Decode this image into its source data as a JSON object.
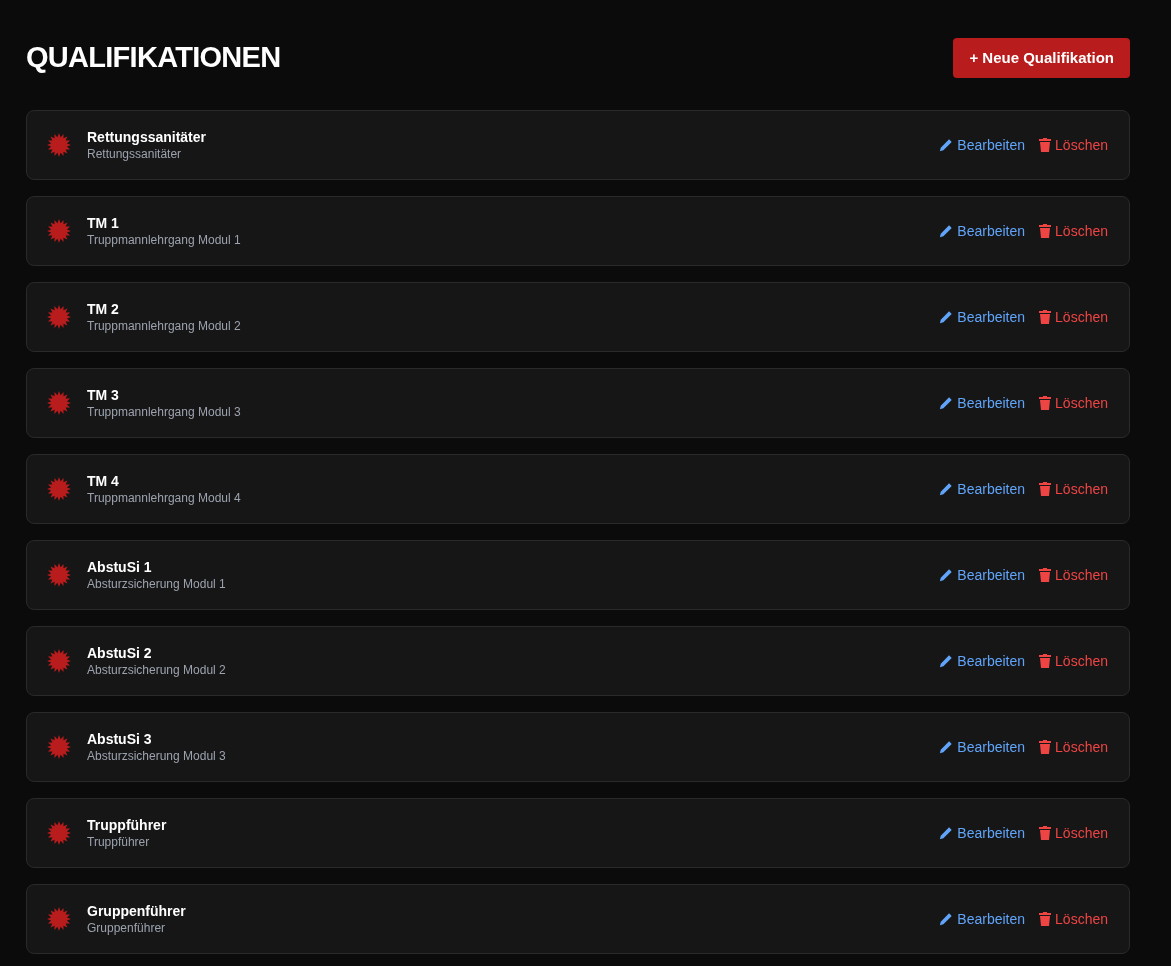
{
  "title": "QUALIFIKATIONEN",
  "add_button": "+ Neue Qualifikation",
  "items": [
    {
      "name": "Rettungssanitäter",
      "description": "Rettungssanitäter",
      "edit": "Bearbeiten",
      "delete": "Löschen"
    },
    {
      "name": "TM 1",
      "description": "Truppmannlehrgang Modul 1",
      "edit": "Bearbeiten",
      "delete": "Löschen"
    },
    {
      "name": "TM 2",
      "description": "Truppmannlehrgang Modul 2",
      "edit": "Bearbeiten",
      "delete": "Löschen"
    },
    {
      "name": "TM 3",
      "description": "Truppmannlehrgang Modul 3",
      "edit": "Bearbeiten",
      "delete": "Löschen"
    },
    {
      "name": "TM 4",
      "description": "Truppmannlehrgang Modul 4",
      "edit": "Bearbeiten",
      "delete": "Löschen"
    },
    {
      "name": "AbstuSi 1",
      "description": "Absturzsicherung Modul 1",
      "edit": "Bearbeiten",
      "delete": "Löschen"
    },
    {
      "name": "AbstuSi 2",
      "description": "Absturzsicherung Modul 2",
      "edit": "Bearbeiten",
      "delete": "Löschen"
    },
    {
      "name": "AbstuSi 3",
      "description": "Absturzsicherung Modul 3",
      "edit": "Bearbeiten",
      "delete": "Löschen"
    },
    {
      "name": "Truppführer",
      "description": "Truppführer",
      "edit": "Bearbeiten",
      "delete": "Löschen"
    },
    {
      "name": "Gruppenführer",
      "description": "Gruppenführer",
      "edit": "Bearbeiten",
      "delete": "Löschen"
    }
  ]
}
